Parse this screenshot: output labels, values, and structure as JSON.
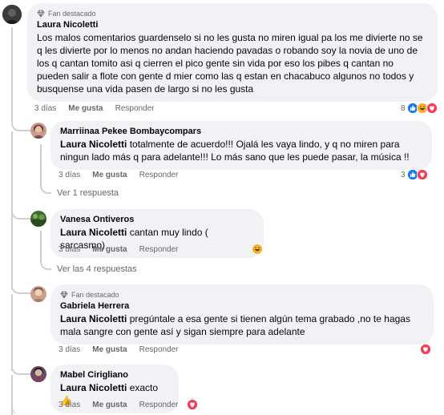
{
  "comments": [
    {
      "badge": "Fan destacado",
      "author": "Laura Nicoletti",
      "mention": "",
      "text": "Los malos comentarios guardenselo si no les gusta no miren igual pa los me divierte no se q les divierte por lo menos no andan haciendo pavadas o robando soy la novia de uno de los q cantan tomito asi q cierren el pico gente sin vida por eso los pibes q cantan no pueden salir a flote con gente d mier como las q estan en chacabuco algunos no todos y busquense una vida pasen de largo si no les gusta",
      "time": "3 días",
      "like": "Me gusta",
      "reply": "Responder",
      "reactions_count": "8"
    },
    {
      "badge": "",
      "author": "Marriinaa Pekee Bombaycompars",
      "mention": "Laura Nicoletti",
      "text": "totalmente de acuerdo!!! Ojalá les vaya lindo, y q no miren para ningun lado más q para adelante!!! Lo más sano que les puede pasar, la música !!",
      "time": "3 días",
      "like": "Me gusta",
      "reply": "Responder",
      "reactions_count": "3",
      "replies_link": "Ver 1 respuesta"
    },
    {
      "badge": "",
      "author": "Vanesa Ontiveros",
      "mention": "Laura Nicoletti",
      "text": "cantan muy lindo ( sarcasmo)",
      "time": "3 días",
      "like": "Me gusta",
      "reply": "Responder",
      "reactions_count": "",
      "replies_link": "Ver las 4 respuestas"
    },
    {
      "badge": "Fan destacado",
      "author": "Gabriela Herrera",
      "mention": "Laura Nicoletti",
      "text": "pregúntale a esa gente si tienen algún tema grabado ,no te hagas mala sangre con gente así y sigan siempre para adelante",
      "time": "3 días",
      "like": "Me gusta",
      "reply": "Responder",
      "reactions_count": ""
    },
    {
      "badge": "",
      "author": "Mabel Cirigliano",
      "mention": "Laura Nicoletti",
      "text": "exacto",
      "emoji": "👍",
      "time": "3 días",
      "like": "Me gusta",
      "reply": "Responder",
      "reactions_count": ""
    }
  ],
  "colors": {
    "like_blue": "#1877f2",
    "love_red": "#f33e58",
    "haha_yellow": "#f7b125",
    "bubble_bg": "#f0f2f5",
    "secondary_text": "#65676b"
  }
}
